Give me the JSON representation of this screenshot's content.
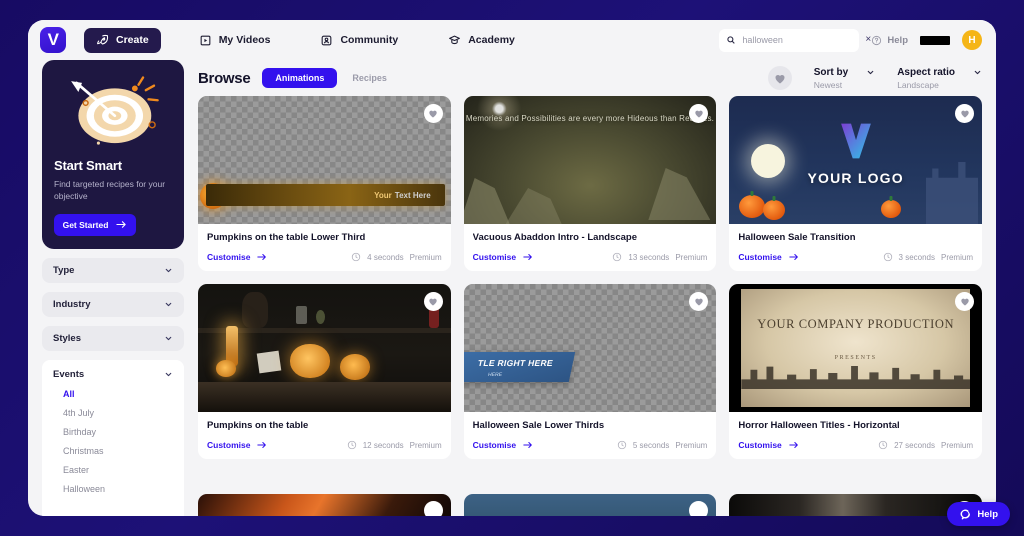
{
  "nav": {
    "logo_letter": "V",
    "items": [
      {
        "label": "Create",
        "icon": "rocket-icon",
        "active": true
      },
      {
        "label": "My Videos",
        "icon": "video-library-icon",
        "active": false
      },
      {
        "label": "Community",
        "icon": "community-icon",
        "active": false
      },
      {
        "label": "Academy",
        "icon": "graduation-cap-icon",
        "active": false
      }
    ],
    "search": {
      "value": "halloween",
      "placeholder": "Search",
      "icon": "search-icon",
      "clear": "×"
    },
    "help": {
      "label": "Help",
      "icon": "question-circle-icon"
    },
    "avatar": {
      "initial": "H",
      "color": "#f5b517"
    }
  },
  "sidebar": {
    "promo": {
      "title": "Start Smart",
      "subtitle": "Find targeted recipes for your objective",
      "button": "Get Started",
      "button_icon": "arrow-right-icon",
      "art": "dartboard-target-icon"
    },
    "filters": [
      {
        "label": "Type",
        "expanded": false
      },
      {
        "label": "Industry",
        "expanded": false
      },
      {
        "label": "Styles",
        "expanded": false
      }
    ],
    "events": {
      "label": "Events",
      "expanded": true,
      "options": [
        "All",
        "4th July",
        "Birthday",
        "Christmas",
        "Easter",
        "Halloween"
      ],
      "selected": "All"
    }
  },
  "main": {
    "title": "Browse",
    "tabs": [
      {
        "label": "Animations",
        "active": true
      },
      {
        "label": "Recipes",
        "active": false
      }
    ],
    "favourites_icon": "heart-icon",
    "controls": [
      {
        "label": "Sort by",
        "value": "Newest"
      },
      {
        "label": "Aspect ratio",
        "value": "Landscape"
      }
    ],
    "customise_label": "Customise",
    "cards": [
      {
        "title": "Pumpkins on the table Lower Third",
        "duration": "4 seconds",
        "tier": "Premium",
        "thumb": "pumpkin-lower-third",
        "overlay_text_1": "Your",
        "overlay_text_2": "Text Here"
      },
      {
        "title": "Vacuous Abaddon Intro - Landscape",
        "duration": "13 seconds",
        "tier": "Premium",
        "thumb": "abaddon-landscape",
        "overlay_text_1": "Memories and Possibilities are every more Hideous than Realities."
      },
      {
        "title": "Halloween Sale Transition",
        "duration": "3 seconds",
        "tier": "Premium",
        "thumb": "halloween-sale-night",
        "overlay_text_1": "YOUR LOGO"
      },
      {
        "title": "Pumpkins on the table",
        "duration": "12 seconds",
        "tier": "Premium",
        "thumb": "pumpkins-photo"
      },
      {
        "title": "Halloween Sale Lower Thirds",
        "duration": "5 seconds",
        "tier": "Premium",
        "thumb": "blue-lower-third",
        "overlay_text_1": "TLE RIGHT HERE",
        "overlay_text_2": "HERE"
      },
      {
        "title": "Horror Halloween Titles - Horizontal",
        "duration": "27 seconds",
        "tier": "Premium",
        "thumb": "sepia-titles",
        "overlay_text_1": "YOUR COMPANY PRODUCTION",
        "overlay_text_2": "PRESENTS"
      }
    ]
  },
  "help_widget": {
    "label": "Help",
    "icon": "chat-bubble-icon"
  },
  "colors": {
    "accent": "#3311ee",
    "dark": "#1e1741",
    "avatar": "#f5b517",
    "page_bg": "#1a1070"
  }
}
